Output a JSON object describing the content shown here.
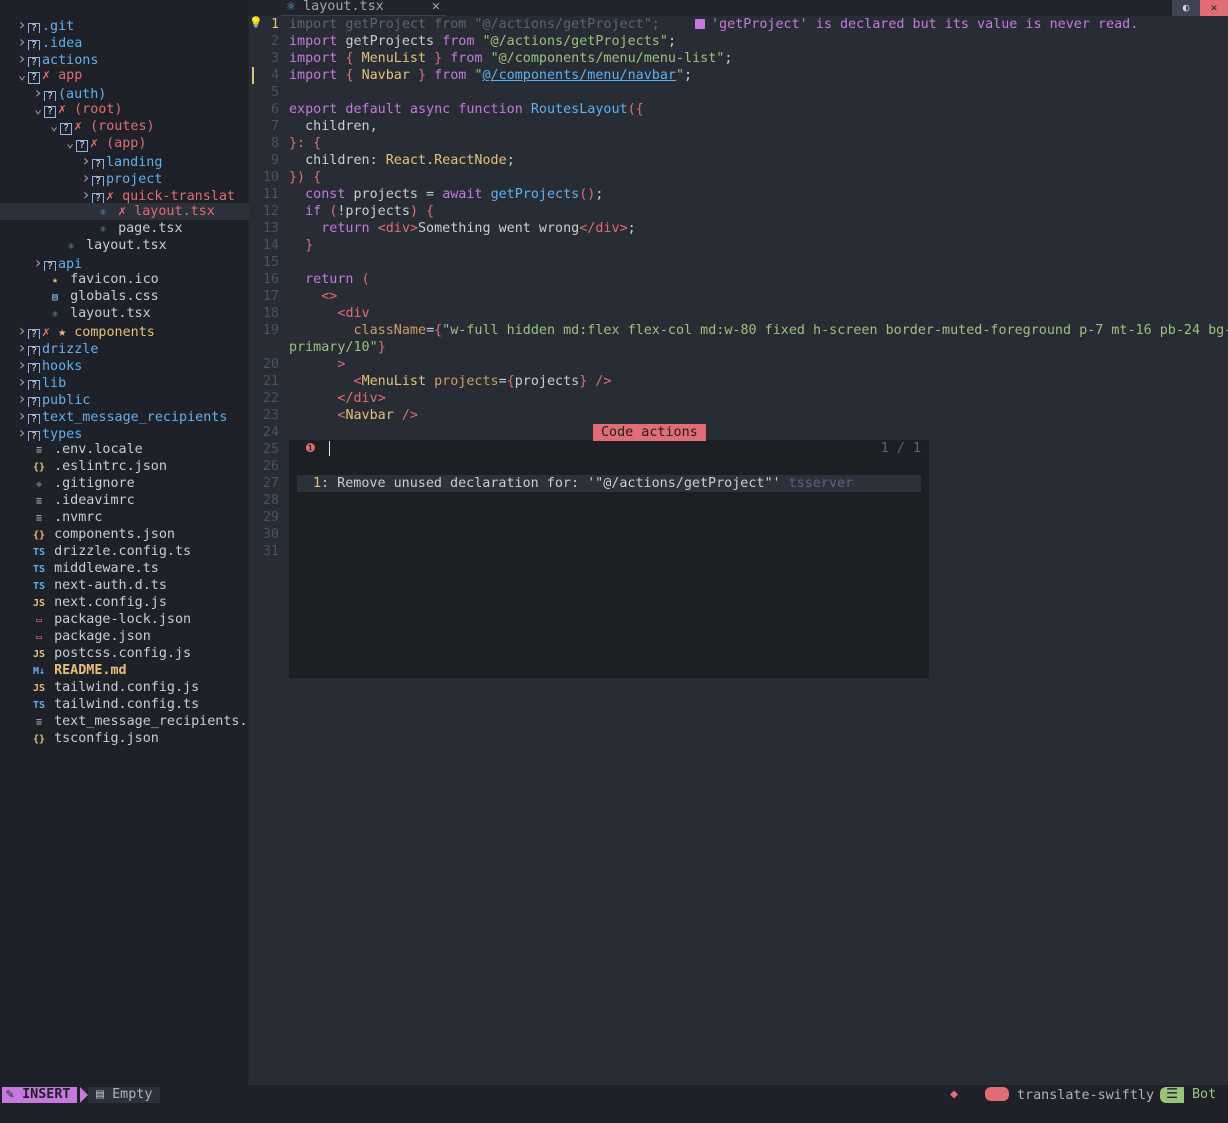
{
  "sidebar": {
    "rows": [
      {
        "type": "dir",
        "name": ".git",
        "indent": 0,
        "open": false
      },
      {
        "type": "dir",
        "name": ".idea",
        "indent": 0,
        "open": false
      },
      {
        "type": "dir",
        "name": "actions",
        "indent": 0,
        "open": false
      },
      {
        "type": "dir",
        "name": "app",
        "indent": 0,
        "open": true,
        "git": "✗"
      },
      {
        "type": "dir",
        "name": "(auth)",
        "indent": 1,
        "open": false
      },
      {
        "type": "dir",
        "name": "(root)",
        "indent": 1,
        "open": true,
        "git": "✗"
      },
      {
        "type": "dir",
        "name": "(routes)",
        "indent": 2,
        "open": true,
        "git": "✗"
      },
      {
        "type": "dir",
        "name": "(app)",
        "indent": 3,
        "open": true,
        "git": "✗"
      },
      {
        "type": "dir",
        "name": "landing",
        "indent": 4,
        "open": false
      },
      {
        "type": "dir",
        "name": "project",
        "indent": 4,
        "open": false
      },
      {
        "type": "dir",
        "name": "quick-translat",
        "indent": 4,
        "open": false,
        "git": "✗"
      },
      {
        "type": "file",
        "name": "layout.tsx",
        "indent": 4,
        "icon": "⚛",
        "git": "✗",
        "selected": true
      },
      {
        "type": "file",
        "name": "page.tsx",
        "indent": 4,
        "icon": "⚛"
      },
      {
        "type": "file",
        "name": "layout.tsx",
        "indent": 2,
        "icon": "⚛"
      },
      {
        "type": "dir",
        "name": "api",
        "indent": 1,
        "open": false
      },
      {
        "type": "file",
        "name": "favicon.ico",
        "indent": 1,
        "icon": "★"
      },
      {
        "type": "file",
        "name": "globals.css",
        "indent": 1,
        "icon": "▤"
      },
      {
        "type": "file",
        "name": "layout.tsx",
        "indent": 1,
        "icon": "⚛"
      },
      {
        "type": "dir",
        "name": "components",
        "indent": 0,
        "open": false,
        "git": "✗",
        "star": "★"
      },
      {
        "type": "dir",
        "name": "drizzle",
        "indent": 0,
        "open": false
      },
      {
        "type": "dir",
        "name": "hooks",
        "indent": 0,
        "open": false
      },
      {
        "type": "dir",
        "name": "lib",
        "indent": 0,
        "open": false
      },
      {
        "type": "dir",
        "name": "public",
        "indent": 0,
        "open": false
      },
      {
        "type": "dir",
        "name": "text_message_recipients",
        "indent": 0,
        "open": false
      },
      {
        "type": "dir",
        "name": "types",
        "indent": 0,
        "open": false
      },
      {
        "type": "file",
        "name": ".env.locale",
        "indent": 0,
        "icon": "≡"
      },
      {
        "type": "file",
        "name": ".eslintrc.json",
        "indent": 0,
        "icon": "{}"
      },
      {
        "type": "file",
        "name": ".gitignore",
        "indent": 0,
        "icon": "◆"
      },
      {
        "type": "file",
        "name": ".ideavimrc",
        "indent": 0,
        "icon": "≡"
      },
      {
        "type": "file",
        "name": ".nvmrc",
        "indent": 0,
        "icon": "≡"
      },
      {
        "type": "file",
        "name": "components.json",
        "indent": 0,
        "icon": "{}"
      },
      {
        "type": "file",
        "name": "drizzle.config.ts",
        "indent": 0,
        "icon": "TS"
      },
      {
        "type": "file",
        "name": "middleware.ts",
        "indent": 0,
        "icon": "TS"
      },
      {
        "type": "file",
        "name": "next-auth.d.ts",
        "indent": 0,
        "icon": "TS"
      },
      {
        "type": "file",
        "name": "next.config.js",
        "indent": 0,
        "icon": "JS"
      },
      {
        "type": "file",
        "name": "package-lock.json",
        "indent": 0,
        "icon": "▭"
      },
      {
        "type": "file",
        "name": "package.json",
        "indent": 0,
        "icon": "▭"
      },
      {
        "type": "file",
        "name": "postcss.config.js",
        "indent": 0,
        "icon": "JS"
      },
      {
        "type": "file",
        "name": "README.md",
        "indent": 0,
        "icon": "M↓",
        "bold": true
      },
      {
        "type": "file",
        "name": "tailwind.config.js",
        "indent": 0,
        "icon": "JS"
      },
      {
        "type": "file",
        "name": "tailwind.config.ts",
        "indent": 0,
        "icon": "TS"
      },
      {
        "type": "file",
        "name": "text_message_recipients.",
        "indent": 0,
        "icon": "≡"
      },
      {
        "type": "file",
        "name": "tsconfig.json",
        "indent": 0,
        "icon": "{}"
      }
    ]
  },
  "tab": {
    "label": "layout.tsx",
    "close": "✕",
    "icon": "⚛"
  },
  "window_buttons": {
    "toggle": "◐",
    "close": "✕"
  },
  "diagnostic": {
    "text": "'getProject' is declared but its value is never read."
  },
  "line_numbers": [
    "1",
    "2",
    "3",
    "4",
    "5",
    "6",
    "7",
    "8",
    "9",
    "10",
    "11",
    "12",
    "13",
    "14",
    "15",
    "16",
    "17",
    "18",
    "19",
    "",
    "20",
    "21",
    "22",
    "23",
    "24",
    "25",
    "26",
    "27",
    "28",
    "29",
    "30",
    "31"
  ],
  "code_lines": [
    [
      [
        "dim",
        "import getProject from \"@/actions/getProject\";"
      ]
    ],
    [
      [
        "kw",
        "import "
      ],
      [
        "plain",
        "getProjects "
      ],
      [
        "kw",
        "from "
      ],
      [
        "str",
        "\"@/actions/getProjects\""
      ],
      [
        "plain",
        ";"
      ]
    ],
    [
      [
        "kw",
        "import "
      ],
      [
        "pun",
        "{ "
      ],
      [
        "ty",
        "MenuList"
      ],
      [
        "pun",
        " } "
      ],
      [
        "kw",
        "from "
      ],
      [
        "str",
        "\"@/components/menu/menu-list\""
      ],
      [
        "plain",
        ";"
      ]
    ],
    [
      [
        "kw",
        "import "
      ],
      [
        "pun",
        "{ "
      ],
      [
        "ty",
        "Navbar"
      ],
      [
        "pun",
        " } "
      ],
      [
        "kw",
        "from "
      ],
      [
        "str",
        "\""
      ],
      [
        "link",
        "@/components/menu/navbar"
      ],
      [
        "str",
        "\""
      ],
      [
        "plain",
        ";"
      ]
    ],
    [],
    [
      [
        "kw",
        "export default async function "
      ],
      [
        "fn",
        "RoutesLayout"
      ],
      [
        "pun",
        "({"
      ]
    ],
    [
      [
        "plain",
        "  children,"
      ]
    ],
    [
      [
        "pun",
        "}: {"
      ]
    ],
    [
      [
        "plain",
        "  children: "
      ],
      [
        "ty",
        "React"
      ],
      [
        "plain",
        "."
      ],
      [
        "ty",
        "ReactNode"
      ],
      [
        "plain",
        ";"
      ]
    ],
    [
      [
        "pun",
        "}) {"
      ]
    ],
    [
      [
        "plain",
        "  "
      ],
      [
        "kw",
        "const "
      ],
      [
        "plain",
        "projects = "
      ],
      [
        "kw",
        "await "
      ],
      [
        "fn",
        "getProjects"
      ],
      [
        "pun",
        "()"
      ],
      [
        "plain",
        ";"
      ]
    ],
    [
      [
        "plain",
        "  "
      ],
      [
        "kw",
        "if "
      ],
      [
        "pun",
        "("
      ],
      [
        "plain",
        "!projects"
      ],
      [
        "pun",
        ") {"
      ]
    ],
    [
      [
        "plain",
        "    "
      ],
      [
        "kw",
        "return "
      ],
      [
        "pun",
        "<"
      ],
      [
        "tag",
        "div"
      ],
      [
        "pun",
        ">"
      ],
      [
        "plain",
        "Something went wrong"
      ],
      [
        "pun",
        "</"
      ],
      [
        "tag",
        "div"
      ],
      [
        "pun",
        ">"
      ],
      [
        "plain",
        ";"
      ]
    ],
    [
      [
        "pun",
        "  }"
      ]
    ],
    [],
    [
      [
        "plain",
        "  "
      ],
      [
        "kw",
        "return "
      ],
      [
        "pun",
        "("
      ]
    ],
    [
      [
        "plain",
        "    "
      ],
      [
        "pun",
        "<>"
      ]
    ],
    [
      [
        "plain",
        "      "
      ],
      [
        "pun",
        "<"
      ],
      [
        "tag",
        "div"
      ]
    ],
    [
      [
        "plain",
        "        "
      ],
      [
        "attr",
        "className"
      ],
      [
        "plain",
        "="
      ],
      [
        "pun",
        "{"
      ],
      [
        "str",
        "\"w-full hidden md:flex flex-col md:w-80 fixed h-screen border-muted-foreground p-7 mt-16 pb-24 bg-"
      ]
    ],
    [
      [
        "str",
        "primary/10\""
      ],
      [
        "pun",
        "}"
      ]
    ],
    [
      [
        "plain",
        "      "
      ],
      [
        "pun",
        ">"
      ]
    ],
    [
      [
        "plain",
        "        "
      ],
      [
        "pun",
        "<"
      ],
      [
        "ty",
        "MenuList "
      ],
      [
        "attr",
        "projects"
      ],
      [
        "plain",
        "="
      ],
      [
        "pun",
        "{"
      ],
      [
        "plain",
        "projects"
      ],
      [
        "pun",
        "}"
      ],
      [
        "plain",
        " "
      ],
      [
        "pun",
        "/>"
      ]
    ],
    [
      [
        "plain",
        "      "
      ],
      [
        "pun",
        "</"
      ],
      [
        "tag",
        "div"
      ],
      [
        "pun",
        ">"
      ]
    ],
    [
      [
        "plain",
        "      "
      ],
      [
        "pun",
        "<"
      ],
      [
        "ty",
        "Navbar "
      ],
      [
        "pun",
        "/>"
      ]
    ]
  ],
  "popup": {
    "title": "Code actions",
    "prompt_icon": "❶",
    "count": "1 / 1",
    "item_index": "1:",
    "item_text": " Remove unused declaration for: '\"@/actions/getProject\"' ",
    "item_source": "tsserver"
  },
  "statusline": {
    "mode": "INSERT",
    "mode_icon": "✎",
    "buffer": "Empty",
    "buffer_icon": "▤",
    "git_icon": "◆",
    "branch": "translate-swiftly",
    "position": "Bot",
    "position_icon": "☰"
  }
}
